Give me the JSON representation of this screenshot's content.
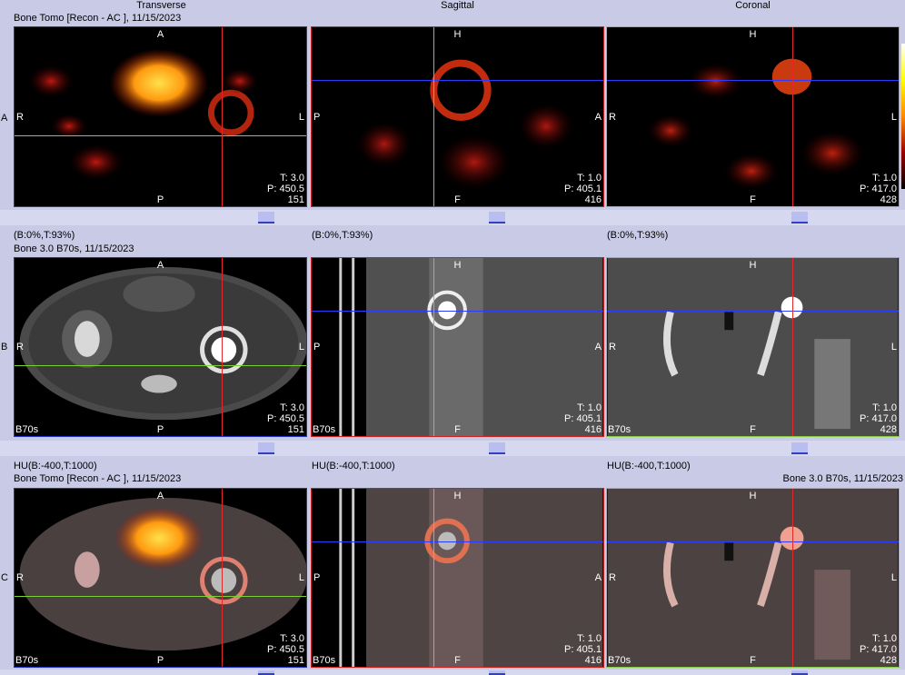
{
  "headers": {
    "transverse": "Transverse",
    "sagittal": "Sagittal",
    "coronal": "Coronal"
  },
  "rows": {
    "A": {
      "label": "A",
      "caption": "Bone Tomo [Recon - AC ], 11/15/2023",
      "window": "(B:0%,T:93%)"
    },
    "B": {
      "label": "B",
      "caption": "Bone  3.0  B70s, 11/15/2023",
      "window": "HU(B:-400,T:1000)"
    },
    "C": {
      "label": "C",
      "caption": "Bone Tomo [Recon - AC ], 11/15/2023",
      "caption_right": "Bone  3.0  B70s, 11/15/2023"
    }
  },
  "orient": {
    "trans": {
      "top": "A",
      "bottom": "P",
      "left": "R",
      "right": "L"
    },
    "sag": {
      "top": "H",
      "bottom": "F",
      "left": "P",
      "right": "A"
    },
    "cor": {
      "top": "H",
      "bottom": "F",
      "left": "R",
      "right": "L"
    }
  },
  "info": {
    "trans": {
      "t": "T: 3.0",
      "p": "P: 450.5",
      "n": "151"
    },
    "sag": {
      "t": "T: 1.0",
      "p": "P: 405.1",
      "n": "416"
    },
    "cor": {
      "t": "T: 1.0",
      "p": "P: 417.0",
      "n": "428"
    }
  },
  "series_label": "B70s"
}
